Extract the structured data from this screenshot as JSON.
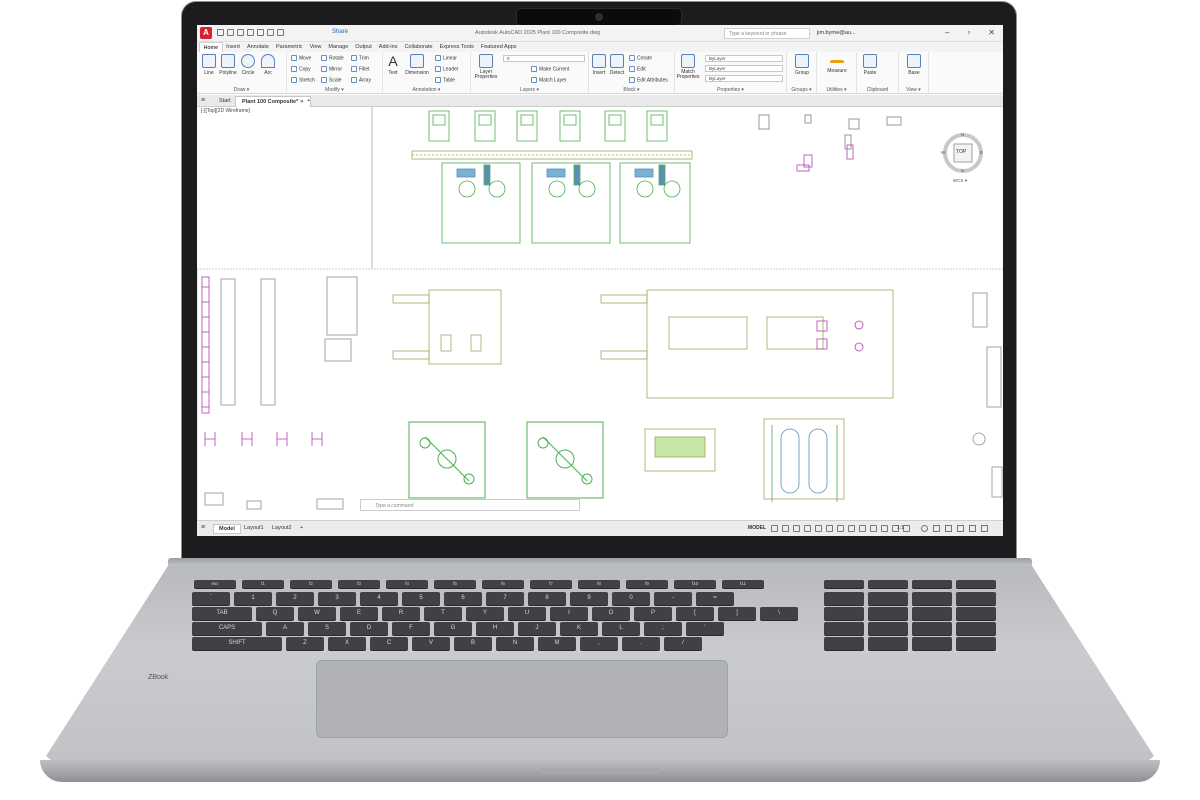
{
  "titlebar": {
    "app_logo": "A",
    "share": "Share",
    "title": "Autodesk AutoCAD 2025   Plant 100 Composite.dwg",
    "search_placeholder": "Type a keyword or phrase",
    "user": "jim.byrne@au...",
    "minimize": "–",
    "restore": "▫",
    "close": "✕"
  },
  "ribbon_tabs": [
    "Home",
    "Insert",
    "Annotate",
    "Parametric",
    "View",
    "Manage",
    "Output",
    "Add-ins",
    "Collaborate",
    "Express Tools",
    "Featured Apps"
  ],
  "ribbon": {
    "draw": {
      "label": "Draw ▾",
      "line": "Line",
      "polyline": "Polyline",
      "circle": "Circle",
      "arc": "Arc"
    },
    "modify": {
      "label": "Modify ▾",
      "move": "Move",
      "rotate": "Rotate",
      "trim": "Trim",
      "copy": "Copy",
      "mirror": "Mirror",
      "fillet": "Fillet",
      "stretch": "Stretch",
      "scale": "Scale",
      "array": "Array"
    },
    "annotation": {
      "label": "Annotation ▾",
      "text": "Text",
      "dimension": "Dimension",
      "linear": "Linear",
      "leader": "Leader",
      "table": "Table"
    },
    "layers": {
      "label": "Layers ▾",
      "layer_properties": "Layer Properties",
      "layer_value": "0",
      "make_current": "Make Current",
      "match_layer": "Match Layer"
    },
    "block": {
      "label": "Block ▾",
      "insert": "Insert",
      "detect": "Detect",
      "create": "Create",
      "edit": "Edit",
      "edit_attributes": "Edit Attributes"
    },
    "properties": {
      "label": "Properties ▾",
      "match_properties": "Match Properties",
      "bylayer1": "ByLayer",
      "bylayer2": "ByLayer",
      "bylayer3": "ByLayer"
    },
    "groups": {
      "label": "Groups ▾",
      "group": "Group"
    },
    "utilities": {
      "label": "Utilities ▾",
      "measure": "Measure"
    },
    "clipboard": {
      "label": "Clipboard",
      "paste": "Paste"
    },
    "view": {
      "label": "View ▾",
      "base": "Base"
    }
  },
  "doc_tabs": {
    "start": "Start",
    "active": "Plant 100 Composite*",
    "close": "✕",
    "new": "+"
  },
  "drawing": {
    "viewport_label": "[-][Top][2D Wireframe]",
    "viewcube": {
      "top": "TOP",
      "n": "N",
      "s": "S",
      "e": "E",
      "w": "W",
      "wcs": "WCS ▾"
    }
  },
  "command": {
    "placeholder": "Type a command"
  },
  "statusbar": {
    "tabs": [
      "Model",
      "Layout1",
      "Layout2"
    ],
    "add": "+",
    "model": "MODEL",
    "scale": "1:1"
  },
  "keyboard": {
    "row1": [
      "esc",
      "f1",
      "f2",
      "f3",
      "f4",
      "f5",
      "f6",
      "f7",
      "f8",
      "f9",
      "f10",
      "f11",
      "f12",
      "home",
      "end",
      "ins",
      "del"
    ],
    "row2": [
      "`",
      "1",
      "2",
      "3",
      "4",
      "5",
      "6",
      "7",
      "8",
      "9",
      "0",
      "-",
      "=",
      "BACKSPACE"
    ],
    "row3": [
      "TAB",
      "Q",
      "W",
      "E",
      "R",
      "T",
      "Y",
      "U",
      "I",
      "O",
      "P",
      "[",
      "]",
      "\\"
    ],
    "row4": [
      "CAPS",
      "A",
      "S",
      "D",
      "F",
      "G",
      "H",
      "J",
      "K",
      "L",
      ";",
      "'",
      "ENTER"
    ],
    "row5": [
      "SHIFT",
      "Z",
      "X",
      "C",
      "V",
      "B",
      "N",
      "M",
      ",",
      ".",
      "/",
      "SHIFT"
    ],
    "row6": [
      "CTRL",
      "FN",
      "⊞",
      "ALT",
      "",
      "ALT",
      "⧉",
      "CTRL"
    ],
    "arrows": [
      "PG UP",
      "PG DN"
    ],
    "brand": "ZBook"
  },
  "colors": {
    "drawing_green": "#4caf50",
    "drawing_olive": "#9aa85a",
    "drawing_magenta": "#b03fb0",
    "accent_blue": "#1a63b3"
  }
}
